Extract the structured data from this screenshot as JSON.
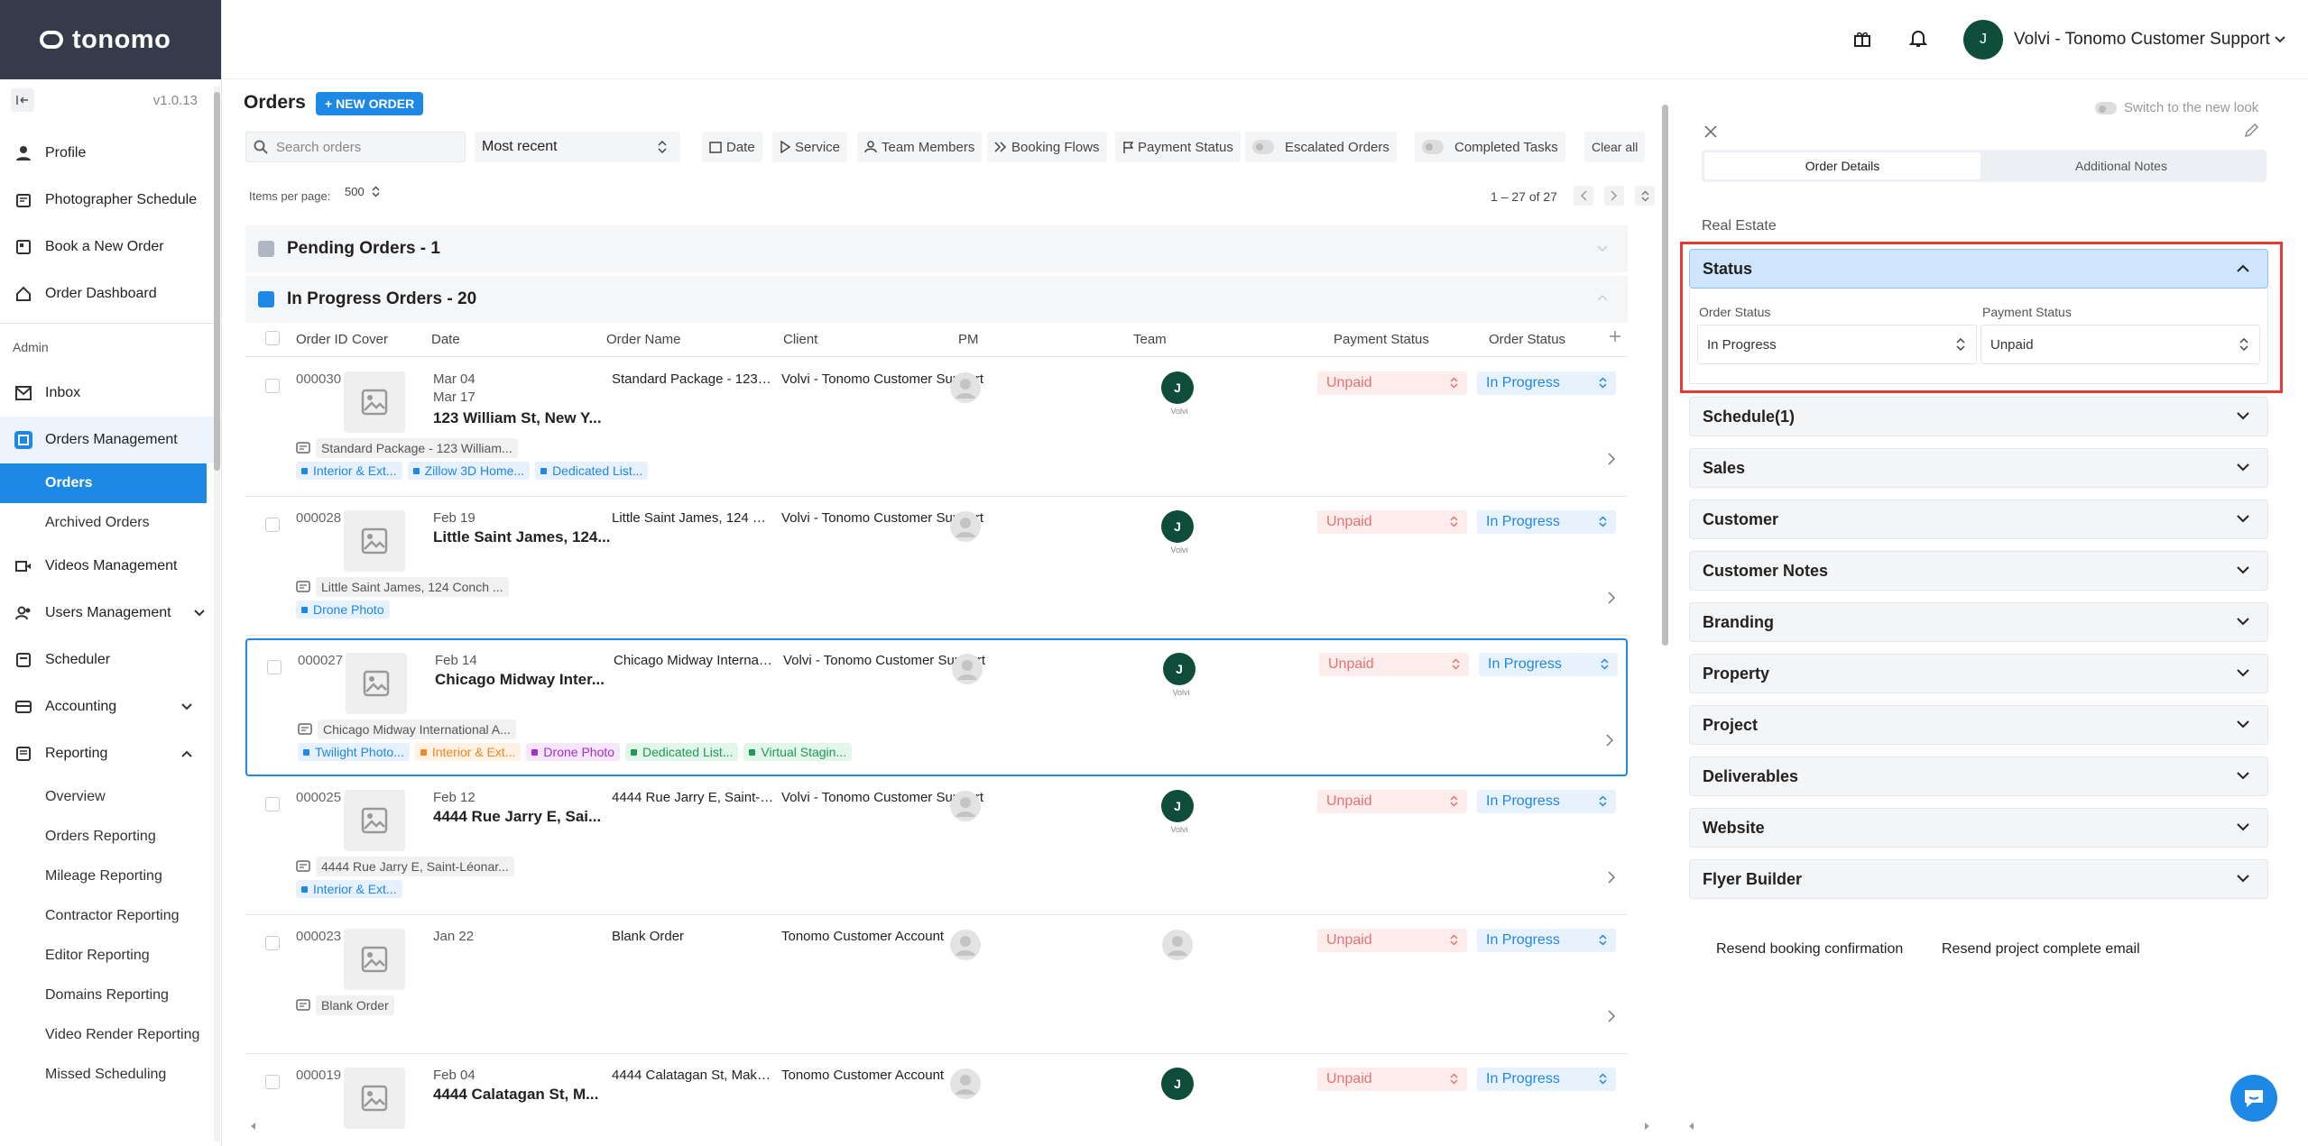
{
  "app": {
    "logo_text": "tonomo",
    "version": "v1.0.13"
  },
  "header": {
    "user_name": "Volvi - Tonomo Customer Support",
    "user_initial": "J"
  },
  "sidebar": {
    "items_top": [
      {
        "label": "Profile",
        "icon": "person-icon"
      },
      {
        "label": "Photographer Schedule",
        "icon": "calendar-icon"
      },
      {
        "label": "Book a New Order",
        "icon": "book-icon"
      },
      {
        "label": "Order Dashboard",
        "icon": "home-icon"
      }
    ],
    "admin_label": "Admin",
    "inbox": "Inbox",
    "orders_management": "Orders Management",
    "orders": "Orders",
    "archived_orders": "Archived Orders",
    "videos_management": "Videos Management",
    "users_management": "Users Management",
    "scheduler": "Scheduler",
    "accounting": "Accounting",
    "reporting": "Reporting",
    "reporting_items": [
      "Overview",
      "Orders Reporting",
      "Mileage Reporting",
      "Contractor Reporting",
      "Editor Reporting",
      "Domains Reporting",
      "Video Render Reporting",
      "Missed Scheduling"
    ]
  },
  "orders": {
    "title": "Orders",
    "new_order": "+ NEW ORDER",
    "search_placeholder": "Search orders",
    "sort": "Most recent",
    "filters": {
      "date": "Date",
      "service": "Service",
      "team": "Team Members",
      "flows": "Booking Flows",
      "payment": "Payment Status",
      "escalated": "Escalated Orders",
      "completed": "Completed Tasks",
      "clear": "Clear all"
    },
    "items_per_page_label": "Items per page:",
    "items_per_page": "500",
    "range": "1 – 27 of 27",
    "pending_group": "Pending Orders - 1",
    "inprogress_group": "In Progress Orders - 20",
    "columns": {
      "id": "Order ID",
      "cover": "Cover",
      "date": "Date",
      "name": "Order Name",
      "client": "Client",
      "pm": "PM",
      "team": "Team",
      "payment": "Payment Status",
      "status": "Order Status"
    },
    "rows": [
      {
        "id": "000030",
        "date1": "Mar 04",
        "date2": "Mar 17",
        "title": "123 William St, New Y...",
        "name": "Standard Package - 123 Wi...",
        "client": "Volvi - Tonomo Customer Support",
        "team_initial": "J",
        "team_label": "Volvi",
        "payment": "Unpaid",
        "status": "In Progress",
        "note": "Standard Package - 123 William...",
        "tags": [
          {
            "t": "Interior & Ext...",
            "c": "blue"
          },
          {
            "t": "Zillow 3D Home...",
            "c": "blue"
          },
          {
            "t": "Dedicated List...",
            "c": "blue"
          }
        ]
      },
      {
        "id": "000028",
        "date1": "Feb 19",
        "date2": "",
        "title": "Little Saint James, 124...",
        "name": "Little Saint James, 124 Con...",
        "client": "Volvi - Tonomo Customer Support",
        "team_initial": "J",
        "team_label": "Volvi",
        "payment": "Unpaid",
        "status": "In Progress",
        "note": "Little Saint James, 124 Conch ...",
        "tags": [
          {
            "t": "Drone Photo",
            "c": "blue"
          }
        ]
      },
      {
        "id": "000027",
        "date1": "Feb 14",
        "date2": "",
        "title": "Chicago Midway Inter...",
        "name": "Chicago Midway Internatio...",
        "client": "Volvi - Tonomo Customer Support",
        "team_initial": "J",
        "team_label": "Volvi",
        "payment": "Unpaid",
        "status": "In Progress",
        "note": "Chicago Midway International A...",
        "tags": [
          {
            "t": "Twilight Photo...",
            "c": "blue"
          },
          {
            "t": "Interior & Ext...",
            "c": "orange"
          },
          {
            "t": "Drone Photo",
            "c": "purple"
          },
          {
            "t": "Dedicated List...",
            "c": "green"
          },
          {
            "t": "Virtual Stagin...",
            "c": "green"
          }
        ]
      },
      {
        "id": "000025",
        "date1": "Feb 12",
        "date2": "",
        "title": "4444 Rue Jarry E, Sai...",
        "name": "4444 Rue Jarry E, Saint-Lé...",
        "client": "Volvi - Tonomo Customer Support",
        "team_initial": "J",
        "team_label": "Volvi",
        "payment": "Unpaid",
        "status": "In Progress",
        "note": "4444 Rue Jarry E, Saint-Léonar...",
        "tags": [
          {
            "t": "Interior & Ext...",
            "c": "blue"
          }
        ]
      },
      {
        "id": "000023",
        "date1": "Jan 22",
        "date2": "",
        "title": "",
        "name": "Blank Order",
        "client": "Tonomo Customer Account",
        "team_initial": "",
        "team_label": "",
        "payment": "Unpaid",
        "status": "In Progress",
        "note": "Blank Order",
        "tags": []
      },
      {
        "id": "000019",
        "date1": "Feb 04",
        "date2": "",
        "title": "4444 Calatagan St, M...",
        "name": "4444 Calatagan St, Makati...",
        "client": "Tonomo Customer Account",
        "team_initial": "J",
        "team_label": "",
        "payment": "Unpaid",
        "status": "In Progress",
        "note": "",
        "tags": []
      }
    ]
  },
  "detail": {
    "switch_label": "Switch to the new look",
    "tab_details": "Order Details",
    "tab_notes": "Additional Notes",
    "category": "Real Estate",
    "status_title": "Status",
    "order_status_label": "Order Status",
    "order_status_value": "In Progress",
    "payment_status_label": "Payment Status",
    "payment_status_value": "Unpaid",
    "sections": [
      "Schedule(1)",
      "Sales",
      "Customer",
      "Customer Notes",
      "Branding",
      "Property",
      "Project",
      "Deliverables",
      "Website",
      "Flyer Builder"
    ],
    "resend_booking": "Resend booking confirmation",
    "resend_complete": "Resend project complete email"
  },
  "colors": {
    "accent": "#1e88e5",
    "header_dark": "#363a4b",
    "highlight_border": "#e53935",
    "avatar": "#0d4d3a"
  }
}
